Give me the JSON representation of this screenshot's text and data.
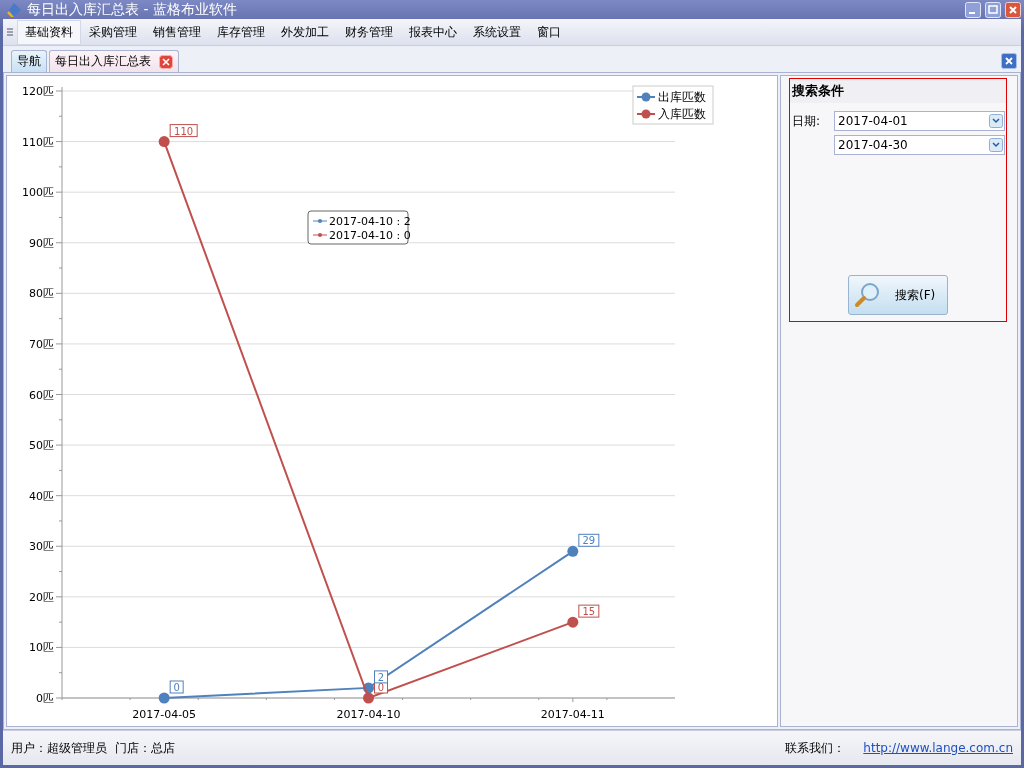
{
  "window": {
    "title": "每日出入库汇总表 - 蓝格布业软件"
  },
  "menu": [
    {
      "label": "基础资料",
      "selected": true
    },
    {
      "label": "采购管理",
      "selected": false
    },
    {
      "label": "销售管理",
      "selected": false
    },
    {
      "label": "库存管理",
      "selected": false
    },
    {
      "label": "外发加工",
      "selected": false
    },
    {
      "label": "财务管理",
      "selected": false
    },
    {
      "label": "报表中心",
      "selected": false
    },
    {
      "label": "系统设置",
      "selected": false
    },
    {
      "label": "窗口",
      "selected": false
    }
  ],
  "tabs": [
    {
      "label": "导航",
      "selected": false,
      "closable": false
    },
    {
      "label": "每日出入库汇总表",
      "selected": true,
      "closable": true
    }
  ],
  "chart": {
    "chart_data": {
      "type": "line",
      "categories": [
        "2017-04-05",
        "2017-04-10",
        "2017-04-11"
      ],
      "series": [
        {
          "name": "出库匹数",
          "color": "#4f81bd",
          "marker": "circle",
          "values": [
            0,
            2,
            29
          ]
        },
        {
          "name": "入库匹数",
          "color": "#c0504d",
          "marker": "circle",
          "values": [
            110,
            0,
            15
          ]
        }
      ],
      "grid": true,
      "legend": "upper right",
      "ylim": [
        0,
        120
      ],
      "yticks": [
        {
          "value": 0,
          "label": "0匹"
        },
        {
          "value": 10,
          "label": "10匹"
        },
        {
          "value": 20,
          "label": "20匹"
        },
        {
          "value": 30,
          "label": "30匹"
        },
        {
          "value": 40,
          "label": "40匹"
        },
        {
          "value": 50,
          "label": "50匹"
        },
        {
          "value": 60,
          "label": "60匹"
        },
        {
          "value": 70,
          "label": "70匹"
        },
        {
          "value": 80,
          "label": "80匹"
        },
        {
          "value": 90,
          "label": "90匹"
        },
        {
          "value": 100,
          "label": "100匹"
        },
        {
          "value": 110,
          "label": "110匹"
        },
        {
          "value": 120,
          "label": "120匹"
        }
      ],
      "data_labels": true
    },
    "tooltip": [
      "2017-04-10 : 2",
      "2017-04-10 : 0"
    ]
  },
  "search": {
    "title": "搜索条件",
    "date_label": "日期:",
    "date_from": "2017-04-01",
    "date_to": "2017-04-30",
    "button": "搜索(F)"
  },
  "status_bar": {
    "user": "用户：超级管理员",
    "store": "门店：总店",
    "contact": "联系我们：",
    "link": "http://www.lange.com.cn"
  }
}
